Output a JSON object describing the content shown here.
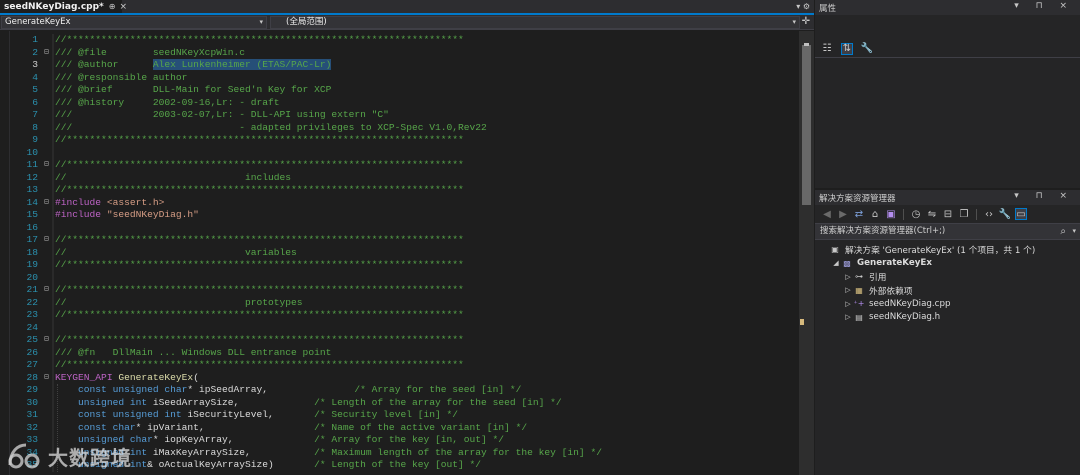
{
  "editor": {
    "tab_title": "seedNKeyDiag.cpp*",
    "tab_pin": "⊕",
    "tab_close": "×",
    "scope_combo": "GenerateKeyEx",
    "member_combo": "(全局范围)",
    "lines": [
      {
        "n": "1",
        "fold": "",
        "parts": [
          [
            "c-comment",
            "//*********************************************************************"
          ]
        ]
      },
      {
        "n": "2",
        "fold": "⊟",
        "parts": [
          [
            "c-comment",
            "/// @file        seedNKeyXcpWin.c"
          ]
        ]
      },
      {
        "n": "3",
        "fold": "",
        "parts": [
          [
            "c-comment",
            "/// @author      "
          ],
          [
            "c-comment hl",
            "Alex Lunkenheimer (ETAS/PAC-Lr)"
          ]
        ]
      },
      {
        "n": "4",
        "fold": "",
        "parts": [
          [
            "c-comment",
            "/// @responsible author"
          ]
        ]
      },
      {
        "n": "5",
        "fold": "",
        "parts": [
          [
            "c-comment",
            "/// @brief       DLL-Main for Seed'n Key for XCP"
          ]
        ]
      },
      {
        "n": "6",
        "fold": "",
        "parts": [
          [
            "c-comment",
            "/// @history     2002-09-16,Lr: - draft"
          ]
        ]
      },
      {
        "n": "7",
        "fold": "",
        "parts": [
          [
            "c-comment",
            "///              2003-02-07,Lr: - DLL-API using extern \"C\""
          ]
        ]
      },
      {
        "n": "8",
        "fold": "",
        "parts": [
          [
            "c-comment",
            "///                             - adapted privileges to XCP-Spec V1.0,Rev22"
          ]
        ]
      },
      {
        "n": "9",
        "fold": "",
        "parts": [
          [
            "c-comment",
            "//*********************************************************************"
          ]
        ]
      },
      {
        "n": "10",
        "fold": "",
        "parts": []
      },
      {
        "n": "11",
        "fold": "⊟",
        "parts": [
          [
            "c-comment",
            "//*********************************************************************"
          ]
        ]
      },
      {
        "n": "12",
        "fold": "",
        "parts": [
          [
            "c-comment",
            "//                               includes"
          ]
        ]
      },
      {
        "n": "13",
        "fold": "",
        "parts": [
          [
            "c-comment",
            "//*********************************************************************"
          ]
        ]
      },
      {
        "n": "14",
        "fold": "⊟",
        "parts": [
          [
            "c-macro",
            "#include "
          ],
          [
            "c-str",
            "<assert.h>"
          ]
        ]
      },
      {
        "n": "15",
        "fold": "",
        "parts": [
          [
            "c-macro",
            "#include "
          ],
          [
            "c-str",
            "\"seedNKeyDiag.h\""
          ]
        ]
      },
      {
        "n": "16",
        "fold": "",
        "parts": []
      },
      {
        "n": "17",
        "fold": "⊟",
        "parts": [
          [
            "c-comment",
            "//*********************************************************************"
          ]
        ]
      },
      {
        "n": "18",
        "fold": "",
        "parts": [
          [
            "c-comment",
            "//                               variables"
          ]
        ]
      },
      {
        "n": "19",
        "fold": "",
        "parts": [
          [
            "c-comment",
            "//*********************************************************************"
          ]
        ]
      },
      {
        "n": "20",
        "fold": "",
        "parts": []
      },
      {
        "n": "21",
        "fold": "⊟",
        "parts": [
          [
            "c-comment",
            "//*********************************************************************"
          ]
        ]
      },
      {
        "n": "22",
        "fold": "",
        "parts": [
          [
            "c-comment",
            "//                               prototypes"
          ]
        ]
      },
      {
        "n": "23",
        "fold": "",
        "parts": [
          [
            "c-comment",
            "//*********************************************************************"
          ]
        ]
      },
      {
        "n": "24",
        "fold": "",
        "parts": []
      },
      {
        "n": "25",
        "fold": "⊟",
        "parts": [
          [
            "c-comment",
            "//*********************************************************************"
          ]
        ]
      },
      {
        "n": "26",
        "fold": "",
        "parts": [
          [
            "c-comment",
            "/// @fn   DllMain ... Windows DLL entrance point"
          ]
        ]
      },
      {
        "n": "27",
        "fold": "",
        "parts": [
          [
            "c-comment",
            "//*********************************************************************"
          ]
        ]
      },
      {
        "n": "28",
        "fold": "⊟",
        "parts": [
          [
            "c-macro",
            "KEYGEN_API "
          ],
          [
            "c-func",
            "GenerateKeyEx"
          ],
          [
            "c-text",
            "("
          ]
        ]
      },
      {
        "n": "29",
        "fold": "",
        "parts": [
          [
            "c-text",
            "    "
          ],
          [
            "c-kw",
            "const unsigned char"
          ],
          [
            "c-text",
            "* ipSeedArray,               "
          ],
          [
            "c-comment",
            "/* Array for the seed [in] */"
          ]
        ]
      },
      {
        "n": "30",
        "fold": "",
        "parts": [
          [
            "c-text",
            "    "
          ],
          [
            "c-kw",
            "unsigned int"
          ],
          [
            "c-text",
            " iSeedArraySize,             "
          ],
          [
            "c-comment",
            "/* Length of the array for the seed [in] */"
          ]
        ]
      },
      {
        "n": "31",
        "fold": "",
        "parts": [
          [
            "c-text",
            "    "
          ],
          [
            "c-kw",
            "const unsigned int"
          ],
          [
            "c-text",
            " iSecurityLevel,       "
          ],
          [
            "c-comment",
            "/* Security level [in] */"
          ]
        ]
      },
      {
        "n": "32",
        "fold": "",
        "parts": [
          [
            "c-text",
            "    "
          ],
          [
            "c-kw",
            "const char"
          ],
          [
            "c-text",
            "* ipVariant,                   "
          ],
          [
            "c-comment",
            "/* Name of the active variant [in] */"
          ]
        ]
      },
      {
        "n": "33",
        "fold": "",
        "parts": [
          [
            "c-text",
            "    "
          ],
          [
            "c-kw",
            "unsigned char"
          ],
          [
            "c-text",
            "* iopKeyArray,              "
          ],
          [
            "c-comment",
            "/* Array for the key [in, out] */"
          ]
        ]
      },
      {
        "n": "34",
        "fold": "",
        "parts": [
          [
            "c-text",
            "    "
          ],
          [
            "c-kw",
            "unsigned int"
          ],
          [
            "c-text",
            " iMaxKeyArraySize,           "
          ],
          [
            "c-comment",
            "/* Maximum length of the array for the key [in] */"
          ]
        ]
      },
      {
        "n": "35",
        "fold": "",
        "parts": [
          [
            "c-text",
            "    "
          ],
          [
            "c-kw",
            "unsigned int"
          ],
          [
            "c-text",
            "& oActualKeyArraySize)       "
          ],
          [
            "c-comment",
            "/* Length of the key [out] */"
          ]
        ]
      }
    ]
  },
  "properties": {
    "title": "属性",
    "header_buttons": "▾ ⊓ ×"
  },
  "solution_explorer": {
    "title": "解决方案资源管理器",
    "header_buttons": "▾ ⊓ ×",
    "search_placeholder": "搜索解决方案资源管理器(Ctrl+;)",
    "items": [
      {
        "label": "解决方案 'GenerateKeyEx' (1 个项目，共 1 个)",
        "indent": 0,
        "exp": "",
        "icon": "solution-icon",
        "bold": false
      },
      {
        "label": "GenerateKeyEx",
        "indent": 1,
        "exp": "◢",
        "icon": "project-icon",
        "bold": true
      },
      {
        "label": "引用",
        "indent": 2,
        "exp": "▷",
        "icon": "references-icon",
        "bold": false
      },
      {
        "label": "外部依赖项",
        "indent": 2,
        "exp": "▷",
        "icon": "external-deps-icon",
        "bold": false
      },
      {
        "label": "seedNKeyDiag.cpp",
        "indent": 2,
        "exp": "▷",
        "icon": "cpp-file-icon",
        "bold": false
      },
      {
        "label": "seedNKeyDiag.h",
        "indent": 2,
        "exp": "▷",
        "icon": "header-file-icon",
        "bold": false
      }
    ]
  },
  "watermark": {
    "text": "大数跨境"
  },
  "colors": {
    "accent": "#007acc",
    "comment": "#57a64a",
    "keyword": "#569cd6",
    "string": "#d69d85",
    "macro": "#bd63c5",
    "function": "#dcdcaa"
  }
}
